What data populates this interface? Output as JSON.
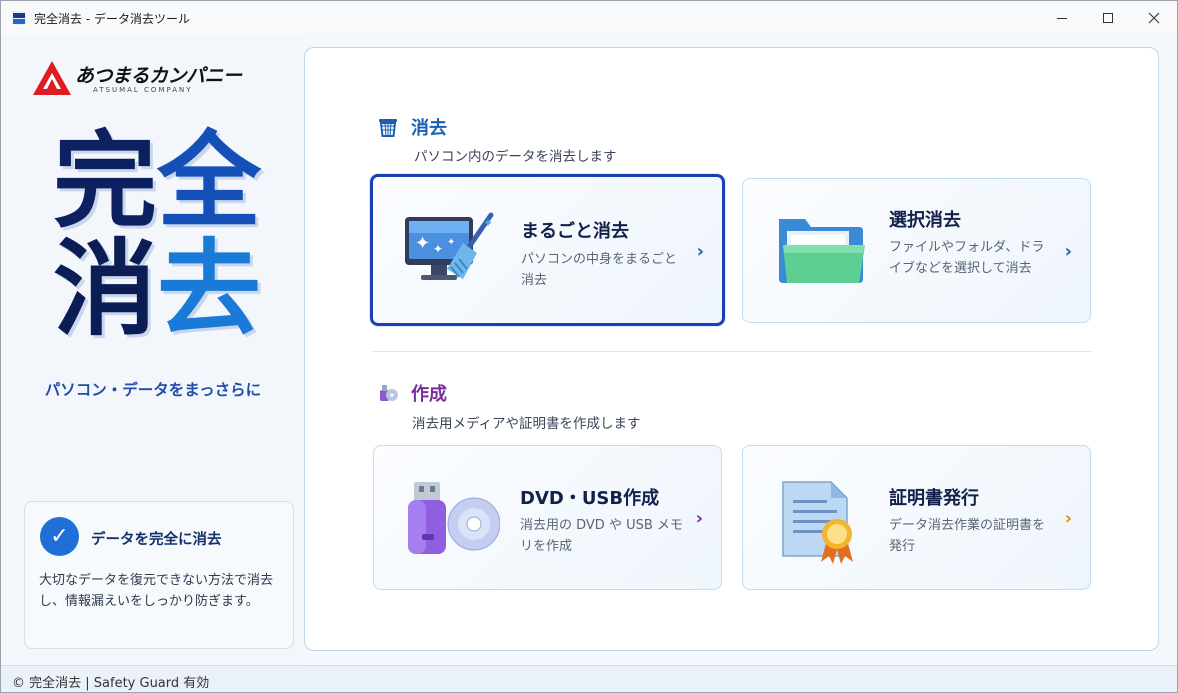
{
  "window": {
    "title": "完全消去 - データ消去ツール"
  },
  "brand": {
    "name": "あつまるカンパニー",
    "sub": "ATSUMAL COMPANY"
  },
  "hero": {
    "chars": [
      "完",
      "全",
      "消",
      "去"
    ],
    "tagline": "パソコン・データをまっさらに"
  },
  "info": {
    "title": "データを完全に消去",
    "body": "大切なデータを復元できない方法で消去し、情報漏えいをしっかり防ぎます。"
  },
  "sections": {
    "erase": {
      "title": "消去",
      "subtitle": "パソコン内のデータを消去します",
      "color": "#1a5fb4"
    },
    "create": {
      "title": "作成",
      "subtitle": "消去用メディアや証明書を作成します",
      "color": "#7a2d9c"
    }
  },
  "cards": {
    "full_erase": {
      "title": "まるごと消去",
      "desc": "パソコンの中身をまるごと消去",
      "icon": "computer-broom-icon",
      "selected": true
    },
    "select_erase": {
      "title": "選択消去",
      "desc": "ファイルやフォルダ、ドライブなどを選択して消去",
      "icon": "folder-icon"
    },
    "media_create": {
      "title": "DVD・USB作成",
      "desc": "消去用の DVD や USB メモリを作成",
      "icon": "usb-dvd-icon"
    },
    "certificate": {
      "title": "証明書発行",
      "desc": "データ消去作業の証明書を発行",
      "icon": "certificate-icon"
    }
  },
  "chevron": "›",
  "status": {
    "text": "© 完全消去 | Safety Guard 有効"
  },
  "colors": {
    "accent": "#1f6fd6",
    "selected_border": "#1b3fb5",
    "chevron_blue": "#1a5fb4",
    "chevron_purple": "#7a2d9c",
    "chevron_orange": "#e38a12"
  }
}
